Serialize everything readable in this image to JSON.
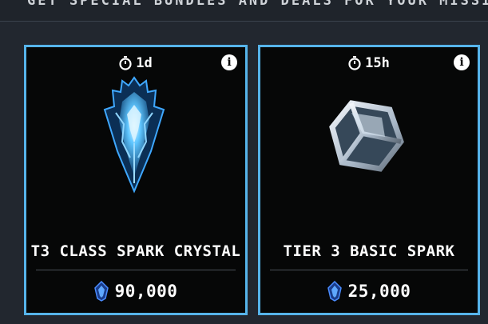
{
  "banner": {
    "text": "GET SPECIAL BUNDLES AND DEALS FOR YOUR MISSIONS, RAIDS AND"
  },
  "cards": [
    {
      "timer": "1d",
      "item_name": "T3 CLASS SPARK CRYSTAL",
      "price": "90,000",
      "item_icon": "spark-crystal-icon",
      "currency_icon": "crystal-currency-icon"
    },
    {
      "timer": "15h",
      "item_name": "TIER 3 BASIC SPARK",
      "price": "25,000",
      "item_icon": "basic-spark-cube-icon",
      "currency_icon": "crystal-currency-icon"
    }
  ],
  "colors": {
    "card_border": "#56b4ea",
    "card_background": "#060707",
    "page_background": "#22272f"
  }
}
